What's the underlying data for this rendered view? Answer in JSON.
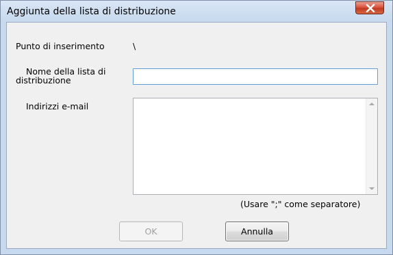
{
  "dialog": {
    "title": "Aggiunta della lista di distribuzione"
  },
  "form": {
    "insertion_point_label": "Punto di inserimento",
    "insertion_point_value": "\\",
    "list_name_label_line1": "Nome della lista di",
    "list_name_label_line2": "distribuzione",
    "list_name_value": "",
    "emails_label": "Indirizzi e-mail",
    "emails_value": "",
    "separator_hint": "(Usare \";\" come separatore)"
  },
  "buttons": {
    "ok_label": "OK",
    "cancel_label": "Annulla"
  },
  "icons": {
    "close": "close-icon",
    "scroll_up": "scroll-up-arrow-icon",
    "scroll_down": "scroll-down-arrow-icon"
  },
  "colors": {
    "close_button": "#c8432b",
    "focus_border": "#5f9ed8",
    "window_frame": "#c7d9ee"
  }
}
